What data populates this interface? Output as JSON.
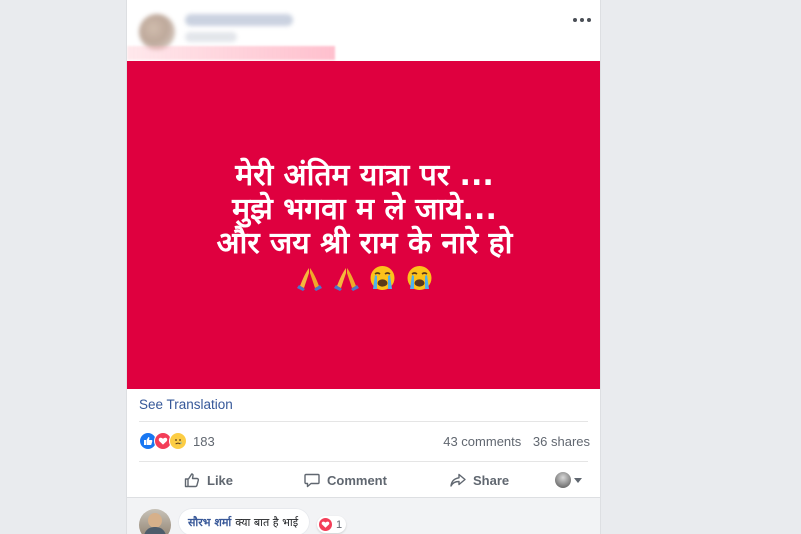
{
  "post": {
    "image_text": {
      "line1": "मेरी अंतिम यात्रा पर ...",
      "line2": "मुझे भगवा म ले जाये...",
      "line3": "और जय श्री राम के नारे हो"
    },
    "image_emojis": [
      "folded-hands",
      "folded-hands",
      "loudly-crying-face",
      "loudly-crying-face"
    ],
    "image_background_color": "#df003f",
    "see_translation": "See Translation"
  },
  "engagement": {
    "reaction_icons": [
      "like",
      "love",
      "sad"
    ],
    "reaction_count": "183",
    "comments": "43 comments",
    "shares": "36 shares"
  },
  "actions": {
    "like": "Like",
    "comment": "Comment",
    "share": "Share"
  },
  "comment": {
    "author": "सौरभ शर्मा",
    "text": "क्या बात है भाई",
    "reaction_icon": "love",
    "reaction_count": "1"
  },
  "colors": {
    "link": "#365899",
    "muted_text": "#616770",
    "page_background": "#e9ebee",
    "like_blue": "#1877f2",
    "love_red": "#f33e58",
    "sad_yellow": "#fccd44"
  }
}
